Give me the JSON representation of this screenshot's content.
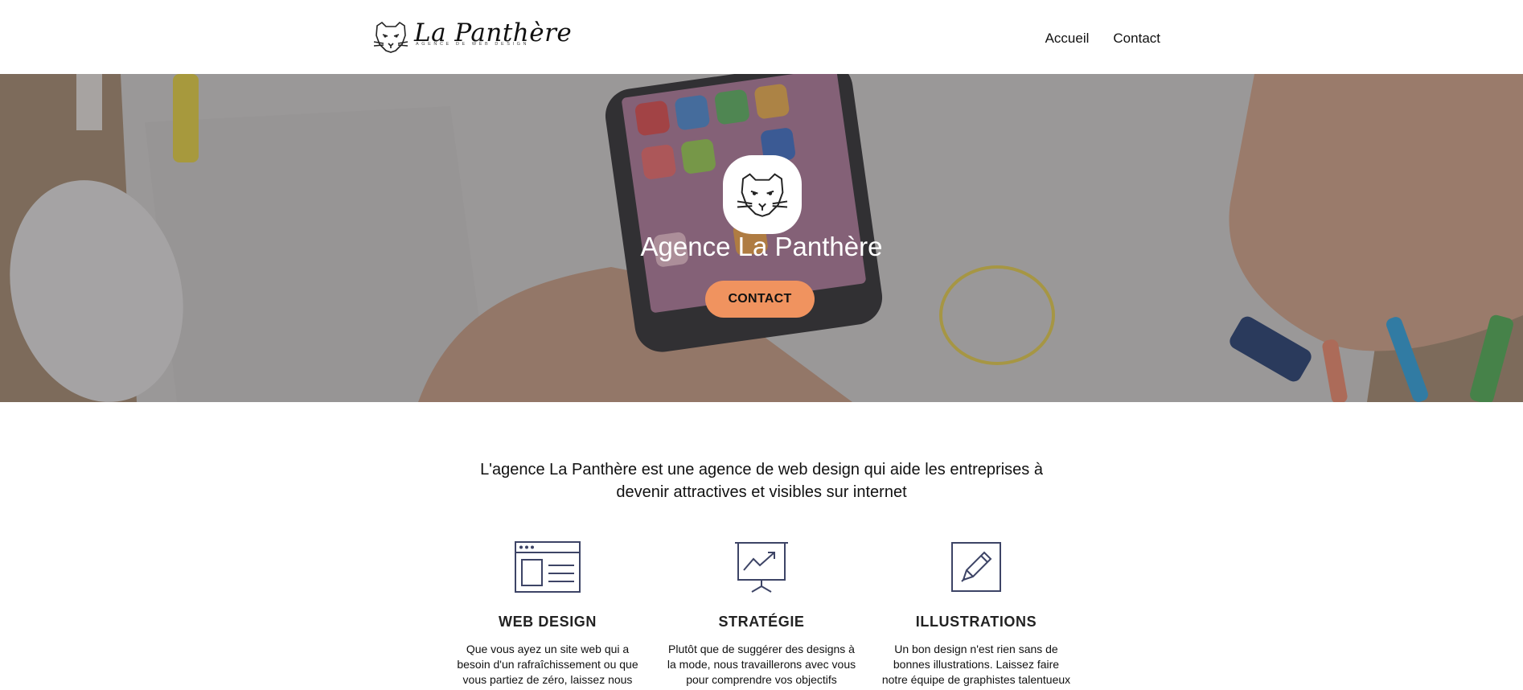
{
  "header": {
    "brand": "La Panthère",
    "tagline": "AGENCE DE WEB DESIGN",
    "nav": [
      {
        "label": "Accueil"
      },
      {
        "label": "Contact"
      }
    ]
  },
  "hero": {
    "title": "Agence La Panthère",
    "cta": "CONTACT",
    "accent": "#f0935f"
  },
  "intro": {
    "text": "L'agence La Panthère est une agence de web design qui aide les entreprises à devenir attractives et visibles sur internet"
  },
  "services": [
    {
      "icon": "browser-window-icon",
      "title": "WEB DESIGN",
      "text": "Que vous ayez un site web qui a besoin d'un rafraîchissement ou que vous partiez de zéro, laissez nous"
    },
    {
      "icon": "presentation-chart-icon",
      "title": "STRATÉGIE",
      "text": "Plutôt que de suggérer des designs à la mode, nous travaillerons avec vous pour comprendre vos objectifs"
    },
    {
      "icon": "pencil-frame-icon",
      "title": "ILLUSTRATIONS",
      "text": "Un bon design n'est rien sans de bonnes illustrations. Laissez faire notre équipe de graphistes talentueux"
    }
  ],
  "colors": {
    "icon_stroke": "#3d4466",
    "text": "#111111"
  }
}
